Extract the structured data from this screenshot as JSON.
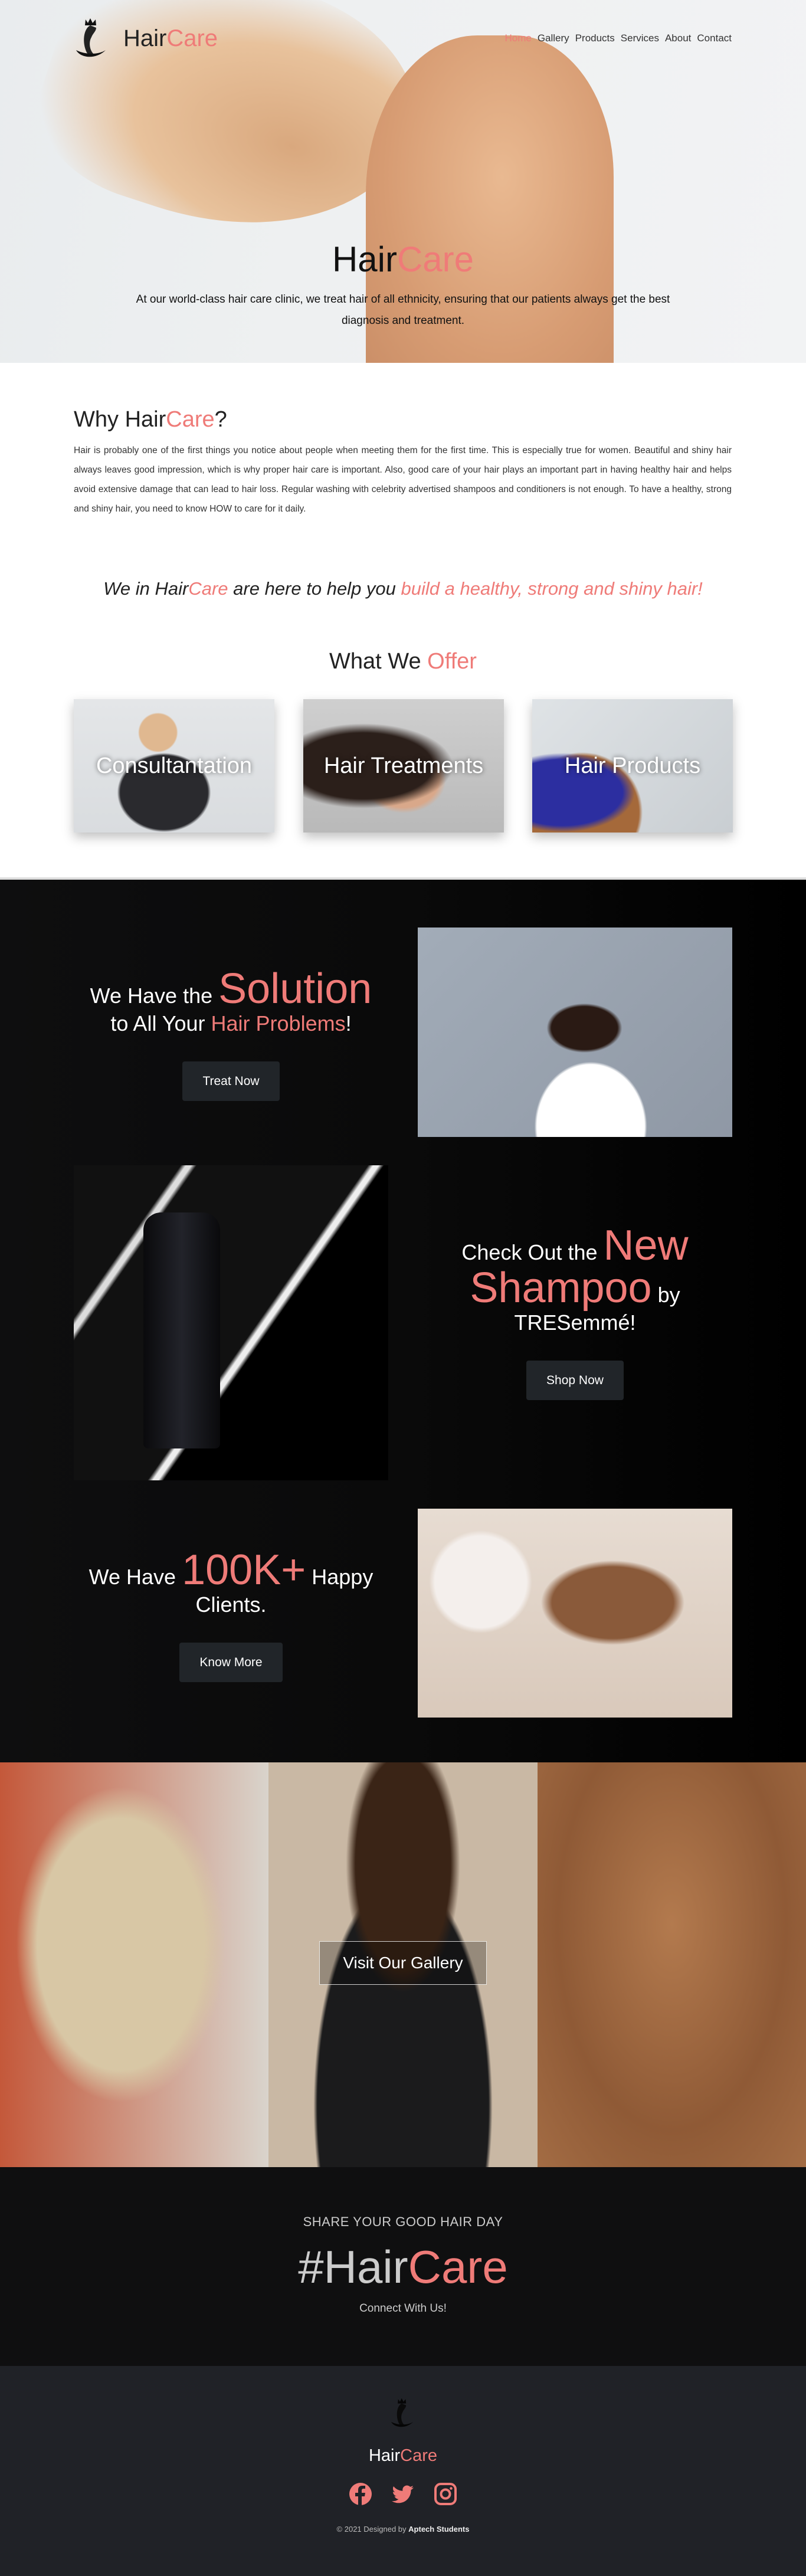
{
  "brand": {
    "part1": "Hair",
    "part2": "Care"
  },
  "nav": {
    "items": [
      "Home",
      "Gallery",
      "Products",
      "Services",
      "About",
      "Contact"
    ],
    "active": "Home"
  },
  "hero": {
    "title_part1": "Hair",
    "title_part2": "Care",
    "subtitle": "At our world-class hair care clinic, we treat hair of all ethnicity, ensuring that our patients always get the best diagnosis and treatment."
  },
  "why": {
    "title_prefix": "Why ",
    "title_part1": "Hair",
    "title_part2": "Care",
    "title_suffix": "?",
    "paragraph": "Hair is probably one of the first things you notice about people when meeting them for the first time. This is especially true for women. Beautiful and shiny hair always leaves good impression, which is why proper hair care is important. Also, good care of your hair plays an important part in having healthy hair and helps avoid extensive damage that can lead to hair loss. Regular washing with celebrity advertised shampoos and conditioners is not enough. To have a healthy, strong and shiny hair, you need to know HOW to care for it daily."
  },
  "tagline": {
    "t1": "We in ",
    "t2": "Hair",
    "t3": "Care",
    "t4": " are here to help you ",
    "t5": "build a healthy, strong and shiny hair!"
  },
  "offer": {
    "title1": "What We ",
    "title2": "Offer",
    "cards": [
      "Consultantation",
      "Hair Treatments",
      "Hair Products"
    ]
  },
  "promos": {
    "solution": {
      "a": "We Have the ",
      "b": "Solution",
      "c": "to All Your ",
      "d": "Hair Problems",
      "e": "!",
      "button": "Treat Now"
    },
    "shampoo": {
      "a": "Check Out the ",
      "b": "New",
      "c": "Shampoo",
      "d": " by",
      "e": "TRESemmé!",
      "button": "Shop Now"
    },
    "clients": {
      "a": "We Have ",
      "b": "100K+",
      "c": " Happy",
      "d": "Clients.",
      "button": "Know More"
    }
  },
  "gallery": {
    "button": "Visit Our Gallery"
  },
  "share": {
    "kicker": "SHARE YOUR GOOD HAIR DAY",
    "hash": "#Hair",
    "hash2": "Care",
    "connect": "Connect With Us!"
  },
  "footer": {
    "copy": "© 2021 Designed by ",
    "author": "Aptech Students",
    "social": [
      "facebook-icon",
      "twitter-icon",
      "instagram-icon"
    ]
  },
  "colors": {
    "accent": "#ef7b78",
    "button": "#212529",
    "footer": "#202227"
  }
}
